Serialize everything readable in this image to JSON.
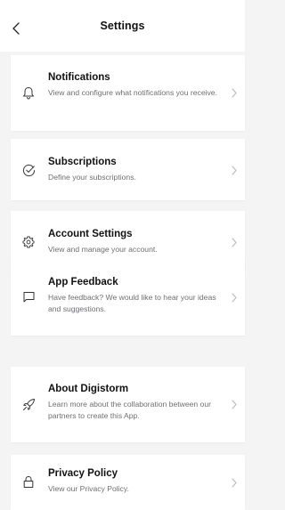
{
  "header": {
    "title": "Settings"
  },
  "items": [
    {
      "title": "Notifications",
      "description": "View and configure what notifications you receive.",
      "icon": "bell-icon"
    },
    {
      "title": "Subscriptions",
      "description": "Define your subscriptions.",
      "icon": "check-circle-icon"
    },
    {
      "title": "Account Settings",
      "description": "View and manage your account.",
      "icon": "gear-icon"
    },
    {
      "title": "App Feedback",
      "description": "Have feedback? We would like to hear your ideas and suggestions.",
      "icon": "chat-bubble-icon"
    },
    {
      "title": "About Digistorm",
      "description": "Learn more about the collaboration between our partners to create this App.",
      "icon": "rocket-icon"
    },
    {
      "title": "Privacy Policy",
      "description": "View our Privacy Policy.",
      "icon": "lock-icon"
    }
  ]
}
